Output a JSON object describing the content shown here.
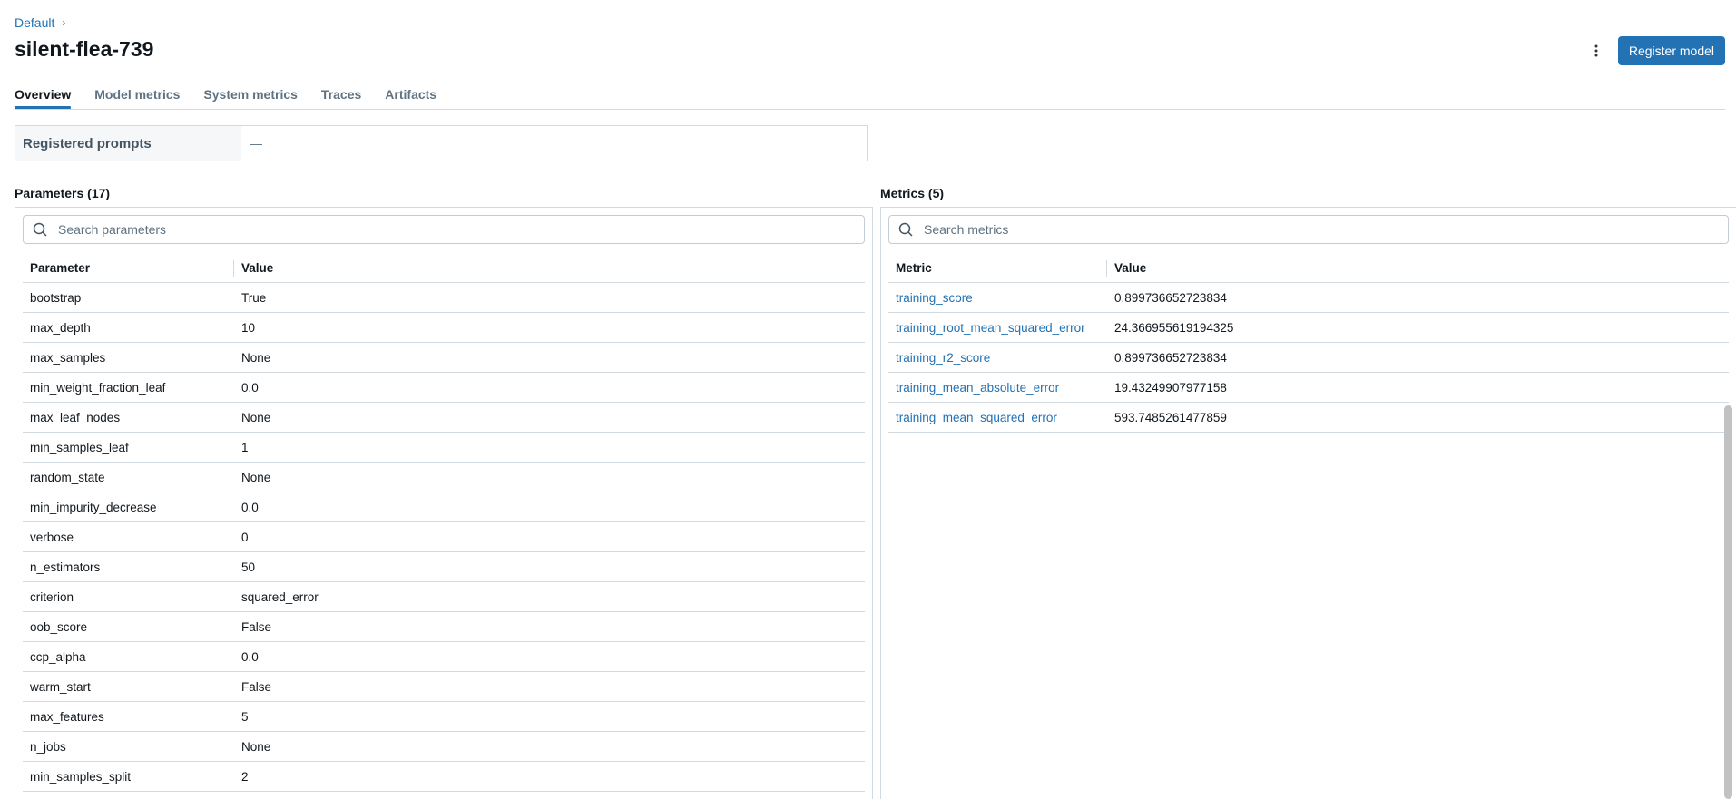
{
  "breadcrumb": {
    "parent": "Default",
    "separator": "›"
  },
  "page": {
    "title": "silent-flea-739"
  },
  "actions": {
    "register_label": "Register model",
    "more_icon": "kebab-vertical-icon"
  },
  "tabs": [
    {
      "label": "Overview",
      "active": true
    },
    {
      "label": "Model metrics"
    },
    {
      "label": "System metrics"
    },
    {
      "label": "Traces"
    },
    {
      "label": "Artifacts"
    }
  ],
  "registered_prompts": {
    "label": "Registered prompts",
    "value": "—"
  },
  "parameters": {
    "title": "Parameters (17)",
    "search_placeholder": "Search parameters",
    "columns": [
      "Parameter",
      "Value"
    ],
    "rows": [
      [
        "bootstrap",
        "True"
      ],
      [
        "max_depth",
        "10"
      ],
      [
        "max_samples",
        "None"
      ],
      [
        "min_weight_fraction_leaf",
        "0.0"
      ],
      [
        "max_leaf_nodes",
        "None"
      ],
      [
        "min_samples_leaf",
        "1"
      ],
      [
        "random_state",
        "None"
      ],
      [
        "min_impurity_decrease",
        "0.0"
      ],
      [
        "verbose",
        "0"
      ],
      [
        "n_estimators",
        "50"
      ],
      [
        "criterion",
        "squared_error"
      ],
      [
        "oob_score",
        "False"
      ],
      [
        "ccp_alpha",
        "0.0"
      ],
      [
        "warm_start",
        "False"
      ],
      [
        "max_features",
        "5"
      ],
      [
        "n_jobs",
        "None"
      ],
      [
        "min_samples_split",
        "2"
      ]
    ]
  },
  "metrics": {
    "title": "Metrics (5)",
    "search_placeholder": "Search metrics",
    "columns": [
      "Metric",
      "Value"
    ],
    "rows": [
      [
        "training_score",
        "0.899736652723834"
      ],
      [
        "training_root_mean_squared_error",
        "24.366955619194325"
      ],
      [
        "training_r2_score",
        "0.899736652723834"
      ],
      [
        "training_mean_absolute_error",
        "19.43249907977158"
      ],
      [
        "training_mean_squared_error",
        "593.7485261477859"
      ]
    ]
  },
  "colors": {
    "accent": "#2272b4",
    "border": "#d1d9e1",
    "text": "#11171c"
  }
}
